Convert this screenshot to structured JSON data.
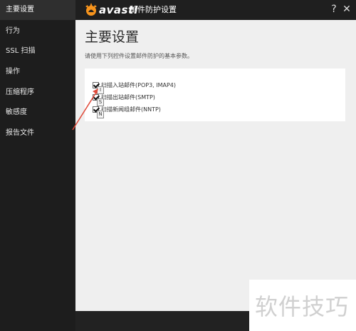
{
  "app": {
    "logo_text": "avast!",
    "window_title": "邮件防护设置"
  },
  "window_buttons": {
    "help": "?",
    "close": "✕"
  },
  "sidebar": {
    "items": [
      {
        "label": "主要设置",
        "active": true
      },
      {
        "label": "行为"
      },
      {
        "label": "SSL 扫描"
      },
      {
        "label": "操作"
      },
      {
        "label": "压缩程序"
      },
      {
        "label": "敏感度"
      },
      {
        "label": "报告文件"
      }
    ]
  },
  "main": {
    "title": "主要设置",
    "description": "请使用下列控件设置邮件防护的基本参数。",
    "options": [
      {
        "label": "扫描入站邮件(POP3, IMAP4)",
        "checked": true,
        "key": "I"
      },
      {
        "label": "扫描出站邮件(SMTP)",
        "checked": true,
        "key": "S"
      },
      {
        "label": "扫描新闻组邮件(NNTP)",
        "checked": true,
        "key": "N"
      }
    ]
  },
  "watermark": "软件技巧",
  "colors": {
    "accent_arrow": "#e04a3a",
    "logo_orange": "#f7941d"
  },
  "icons": {
    "help": "help-icon",
    "close": "close-icon",
    "logo": "avast-logo-icon"
  }
}
